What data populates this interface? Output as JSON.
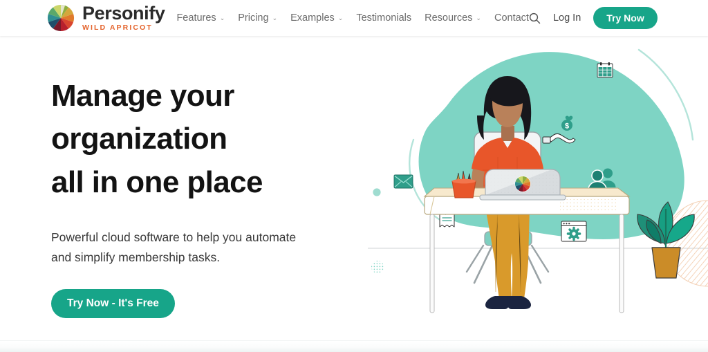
{
  "header": {
    "brand": {
      "name": "Personify",
      "tagline": "WILD APRICOT",
      "logo_icon": "color-wheel-logo"
    },
    "nav": [
      {
        "label": "Features",
        "has_dropdown": true,
        "caret": "⌄"
      },
      {
        "label": "Pricing",
        "has_dropdown": true,
        "caret": "⌄"
      },
      {
        "label": "Examples",
        "has_dropdown": true,
        "caret": "⌄"
      },
      {
        "label": "Testimonials",
        "has_dropdown": false,
        "caret": ""
      },
      {
        "label": "Resources",
        "has_dropdown": true,
        "caret": "⌄"
      },
      {
        "label": "Contact",
        "has_dropdown": false,
        "caret": ""
      }
    ],
    "search_icon": "search-icon",
    "login_label": "Log In",
    "try_now_label": "Try Now"
  },
  "hero": {
    "headline_line1": "Manage your organization",
    "headline_line2": "all in one place",
    "subhead_line1": "Powerful cloud software to help you automate",
    "subhead_line2": "and simplify membership tasks.",
    "cta_label": "Try Now - It's Free",
    "illustration": {
      "description": "Woman working at a desk with a laptop",
      "floating_icons": [
        "calendar-icon",
        "hand-with-money-icon",
        "envelope-icon",
        "invoice-receipt-icon",
        "group-people-icon",
        "settings-window-icon"
      ],
      "objects": [
        "teal-blob-background",
        "desk",
        "laptop",
        "office-chair",
        "pencil-cup",
        "potted-plant",
        "ground-line",
        "striped-circle-decoration",
        "teal-dot",
        "halftone-dot"
      ]
    }
  },
  "colors": {
    "accent_teal": "#17a589",
    "brand_orange": "#e4622a",
    "blob_mint": "#7ed4c4",
    "shirt_orange": "#e8562a",
    "pants_mustard": "#d99a2b",
    "heading_dark": "#131313",
    "nav_grey": "#6b6b6b",
    "plant_green": "#179e82",
    "pot_ochre": "#cb8c28",
    "skin_tone": "#b9815a",
    "hair_black": "#17171c"
  }
}
